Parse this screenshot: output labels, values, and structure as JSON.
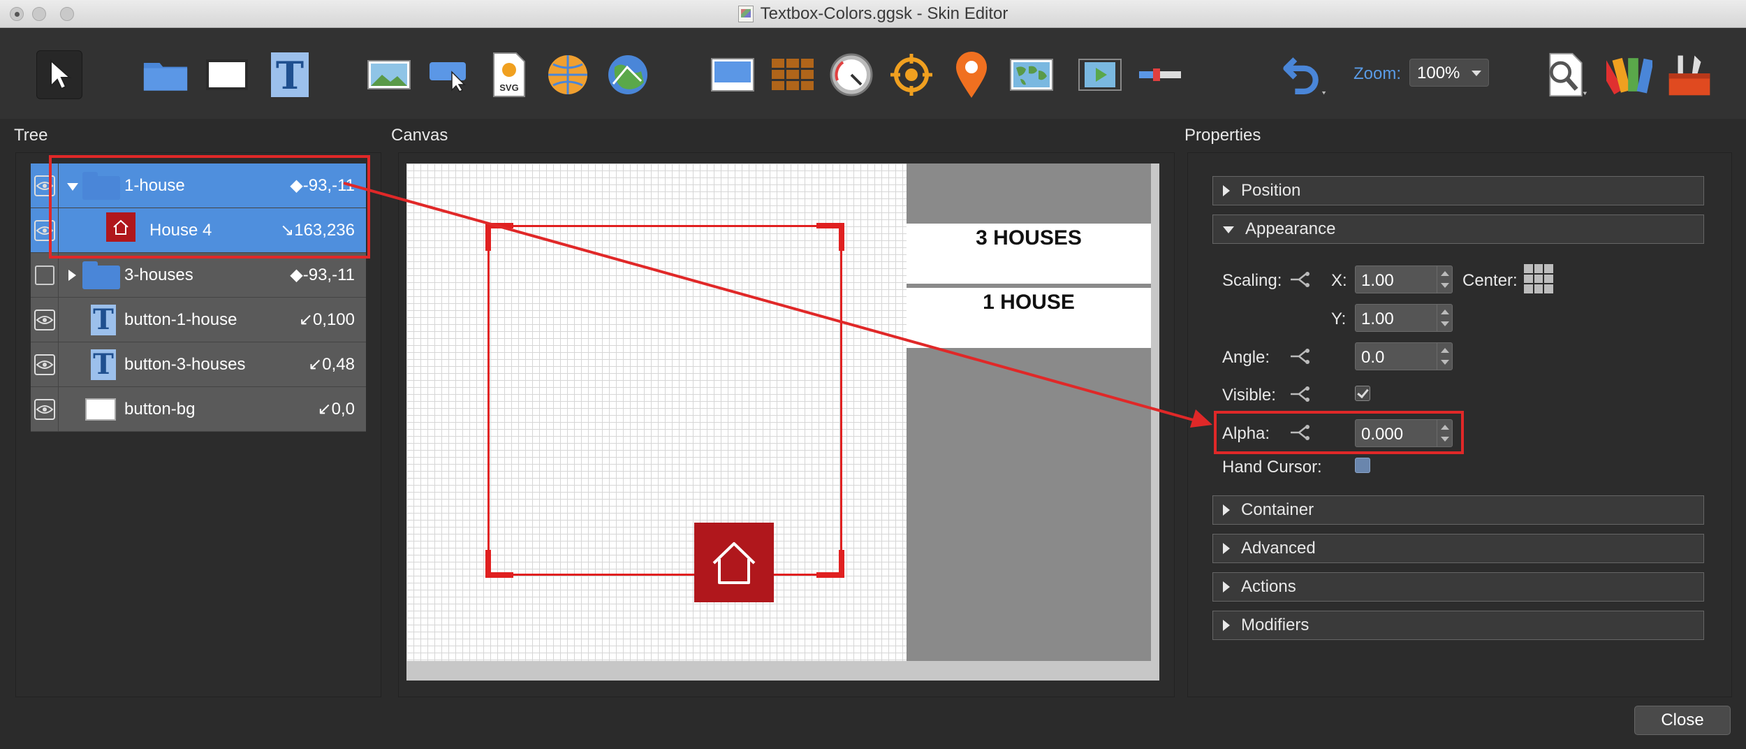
{
  "window": {
    "title": "Textbox-Colors.ggsk - Skin Editor"
  },
  "toolbar": {
    "tools": [
      "select-tool",
      "container-tool",
      "rectangle-tool",
      "text-tool",
      "image-tool",
      "button-tool",
      "svg-tool",
      "hotspot-tool",
      "map-tool",
      "cloner-tool",
      "grid-tool",
      "dial-tool",
      "target-tool",
      "pin-tool",
      "map-image-tool",
      "video-tool",
      "slider-tool",
      "undo-tool",
      "search-tool",
      "palette-tool",
      "toolbox-tool"
    ],
    "svg_label": "SVG",
    "zoom_label": "Zoom:",
    "zoom_value": "100%"
  },
  "sections": {
    "tree": "Tree",
    "canvas": "Canvas",
    "properties": "Properties"
  },
  "tree": {
    "rows": [
      {
        "label": "1-house",
        "value": "◆-93,-11"
      },
      {
        "label": "House 4",
        "value": "↘163,236"
      },
      {
        "label": "3-houses",
        "value": "◆-93,-11"
      },
      {
        "label": "button-1-house",
        "value": "↙0,100"
      },
      {
        "label": "button-3-houses",
        "value": "↙0,48"
      },
      {
        "label": "button-bg",
        "value": "↙0,0"
      }
    ]
  },
  "canvas": {
    "button_3": "3 HOUSES",
    "button_1": "1 HOUSE"
  },
  "properties": {
    "sections": {
      "position": "Position",
      "appearance": "Appearance",
      "container": "Container",
      "advanced": "Advanced",
      "actions": "Actions",
      "modifiers": "Modifiers"
    },
    "scaling_label": "Scaling:",
    "x_label": "X:",
    "x_value": "1.00",
    "center_label": "Center:",
    "y_label": "Y:",
    "y_value": "1.00",
    "angle_label": "Angle:",
    "angle_value": "0.0",
    "visible_label": "Visible:",
    "alpha_label": "Alpha:",
    "alpha_value": "0.000",
    "hand_cursor_label": "Hand Cursor:"
  },
  "footer": {
    "close_label": "Close"
  },
  "colors": {
    "accent": "#4f8fdd",
    "highlight": "#e02828",
    "house_red": "#b0171c"
  }
}
